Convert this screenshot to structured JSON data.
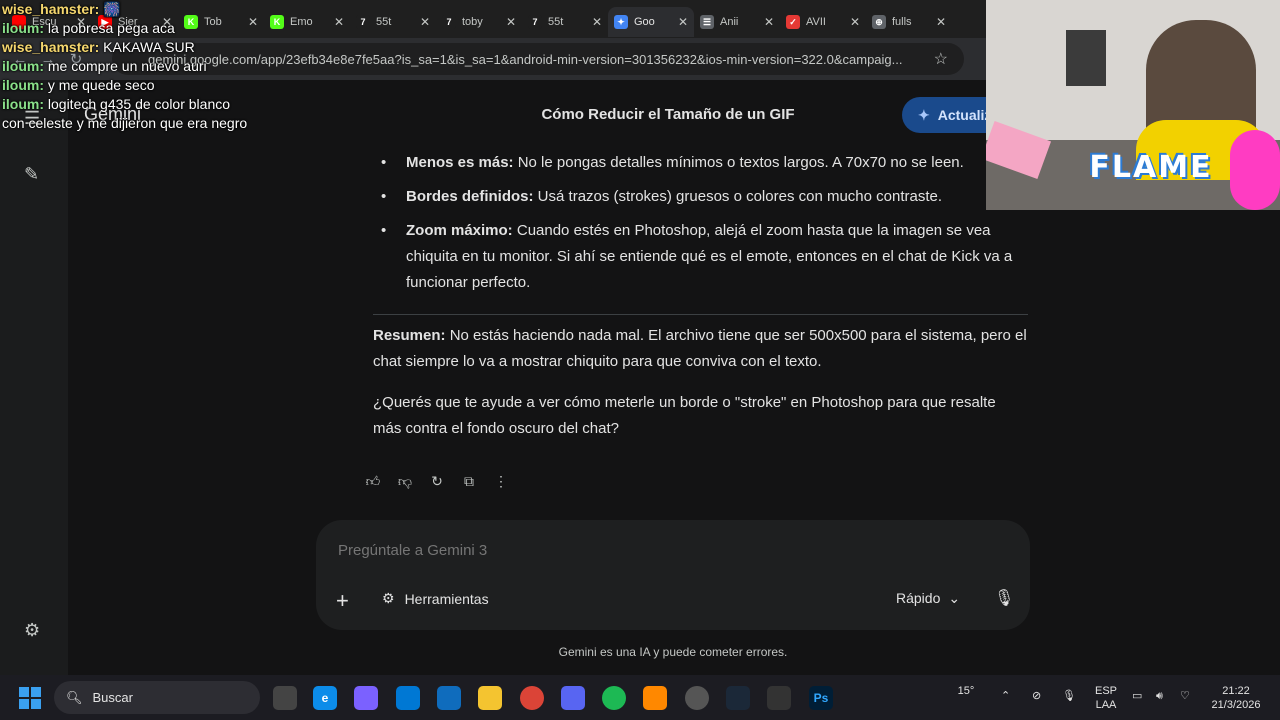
{
  "browser": {
    "tabs": [
      {
        "title": "Escu",
        "fav_color": "#ff0000",
        "fav_text": ""
      },
      {
        "title": "Sier",
        "fav_color": "#ff0000",
        "fav_text": "▶"
      },
      {
        "title": "Tob",
        "fav_color": "#53fc18",
        "fav_text": "K"
      },
      {
        "title": "Emo",
        "fav_color": "#53fc18",
        "fav_text": "K"
      },
      {
        "title": "55t",
        "fav_color": "#1f1f1f",
        "fav_text": "7"
      },
      {
        "title": "toby",
        "fav_color": "#1f1f1f",
        "fav_text": "7"
      },
      {
        "title": "55t",
        "fav_color": "#1f1f1f",
        "fav_text": "7"
      },
      {
        "title": "Goo",
        "fav_color": "#4285f4",
        "fav_text": "✦"
      },
      {
        "title": "Anii",
        "fav_color": "#5f6368",
        "fav_text": "☰"
      },
      {
        "title": "AVII",
        "fav_color": "#e53935",
        "fav_text": "✓"
      },
      {
        "title": "fulls",
        "fav_color": "#5f6368",
        "fav_text": "⊕"
      }
    ],
    "url": "gemini.google.com/app/23efb34e8e7fe5aa?is_sa=1&is_sa=1&android-min-version=301356232&ios-min-version=322.0&campaig..."
  },
  "gemini": {
    "brand": "Gemini",
    "conversation_title": "Cómo Reducir el Tamaño de un GIF",
    "upgrade_label": "Actualiz",
    "bullets": [
      {
        "bold": "Menos es más:",
        "text": " No le pongas detalles mínimos o textos largos. A 70x70 no se leen."
      },
      {
        "bold": "Bordes definidos:",
        "text": " Usá trazos (strokes) gruesos o colores con mucho contraste."
      },
      {
        "bold": "Zoom máximo:",
        "text": " Cuando estés en Photoshop, alejá el zoom hasta que la imagen se vea chiquita en tu monitor. Si ahí se entiende qué es el emote, entonces en el chat de Kick va a funcionar perfecto."
      }
    ],
    "summary_bold": "Resumen:",
    "summary_text": " No estás haciendo nada mal. El archivo tiene que ser 500x500 para el sistema, pero el chat siempre lo va a mostrar chiquito para que conviva con el texto.",
    "question": "¿Querés que te ayude a ver cómo meterle un borde o \"stroke\" en Photoshop para que resalte más contra el fondo oscuro del chat?",
    "prompt_placeholder": "Pregúntale a Gemini 3",
    "tools_label": "Herramientas",
    "mode_label": "Rápido",
    "disclaimer": "Gemini es una IA y puede cometer errores."
  },
  "chat_overlay": [
    {
      "user": "wise_hamster:",
      "msg": " 🎆",
      "style": "w"
    },
    {
      "user": "iloum:",
      "msg": " la pobresa pega aca",
      "style": "u"
    },
    {
      "user": "wise_hamster:",
      "msg": " KAKAWA SUR",
      "style": "w"
    },
    {
      "user": "iloum:",
      "msg": " me compre un nuevo auri",
      "style": "u"
    },
    {
      "user": "iloum:",
      "msg": " y me quede seco",
      "style": "u"
    },
    {
      "user": "iloum:",
      "msg": " logitech g435 de color blanco con celeste y me dijieron que era negro",
      "style": "u"
    }
  ],
  "webcam": {
    "overlay_text": "FLAME"
  },
  "taskbar": {
    "search_label": "Buscar",
    "weather": "15°",
    "language": "ESP",
    "layout": "LAA",
    "time": "21:22",
    "date": "21/3/2026"
  }
}
